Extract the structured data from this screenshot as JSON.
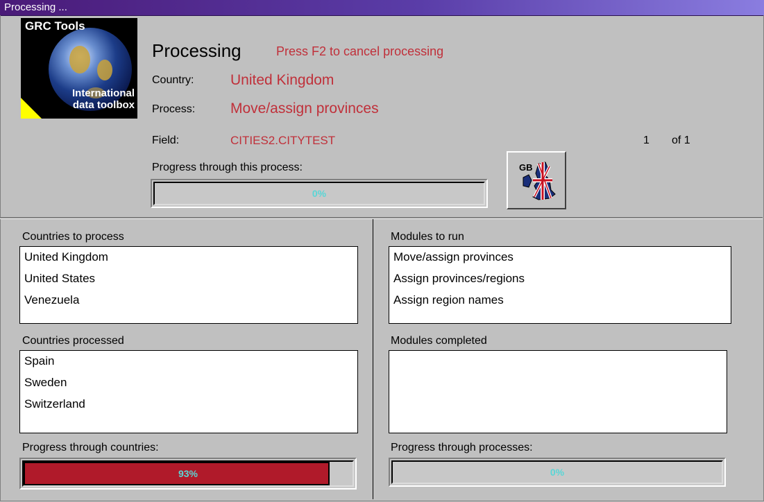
{
  "window": {
    "title": "Processing ..."
  },
  "logo": {
    "line1": "GRC Tools",
    "line2": "International",
    "line3": "data toolbox"
  },
  "header": {
    "title": "Processing",
    "cancel_hint": "Press F2 to cancel processing",
    "country_label": "Country:",
    "country_value": "United Kingdom",
    "process_label": "Process:",
    "process_value": "Move/assign provinces",
    "field_label": "Field:",
    "field_value": "CITIES2.CITYTEST",
    "count_current": "1",
    "count_of": "of 1",
    "progress_label": "Progress through this process:",
    "progress_text": "0%",
    "progress_value": 0,
    "flag_code": "GB",
    "flag_icon": "uk-map-flag-icon"
  },
  "countries_to_process": {
    "label": "Countries to process",
    "items": [
      "United Kingdom",
      "United States",
      "Venezuela"
    ]
  },
  "countries_processed": {
    "label": "Countries processed",
    "items": [
      "Spain",
      "Sweden",
      "Switzerland"
    ]
  },
  "modules_to_run": {
    "label": "Modules to run",
    "items": [
      "Move/assign provinces",
      "Assign provinces/regions",
      "Assign region names"
    ]
  },
  "modules_completed": {
    "label": "Modules completed",
    "items": []
  },
  "progress_countries": {
    "label": "Progress through countries:",
    "text": "93%",
    "value": 0.93
  },
  "progress_processes": {
    "label": "Progress through processes:",
    "text": "0%",
    "value": 0
  },
  "colors": {
    "accent_red": "#c0303a",
    "progress_fill": "#b01a2a",
    "percent_text": "#5ad6d6"
  }
}
